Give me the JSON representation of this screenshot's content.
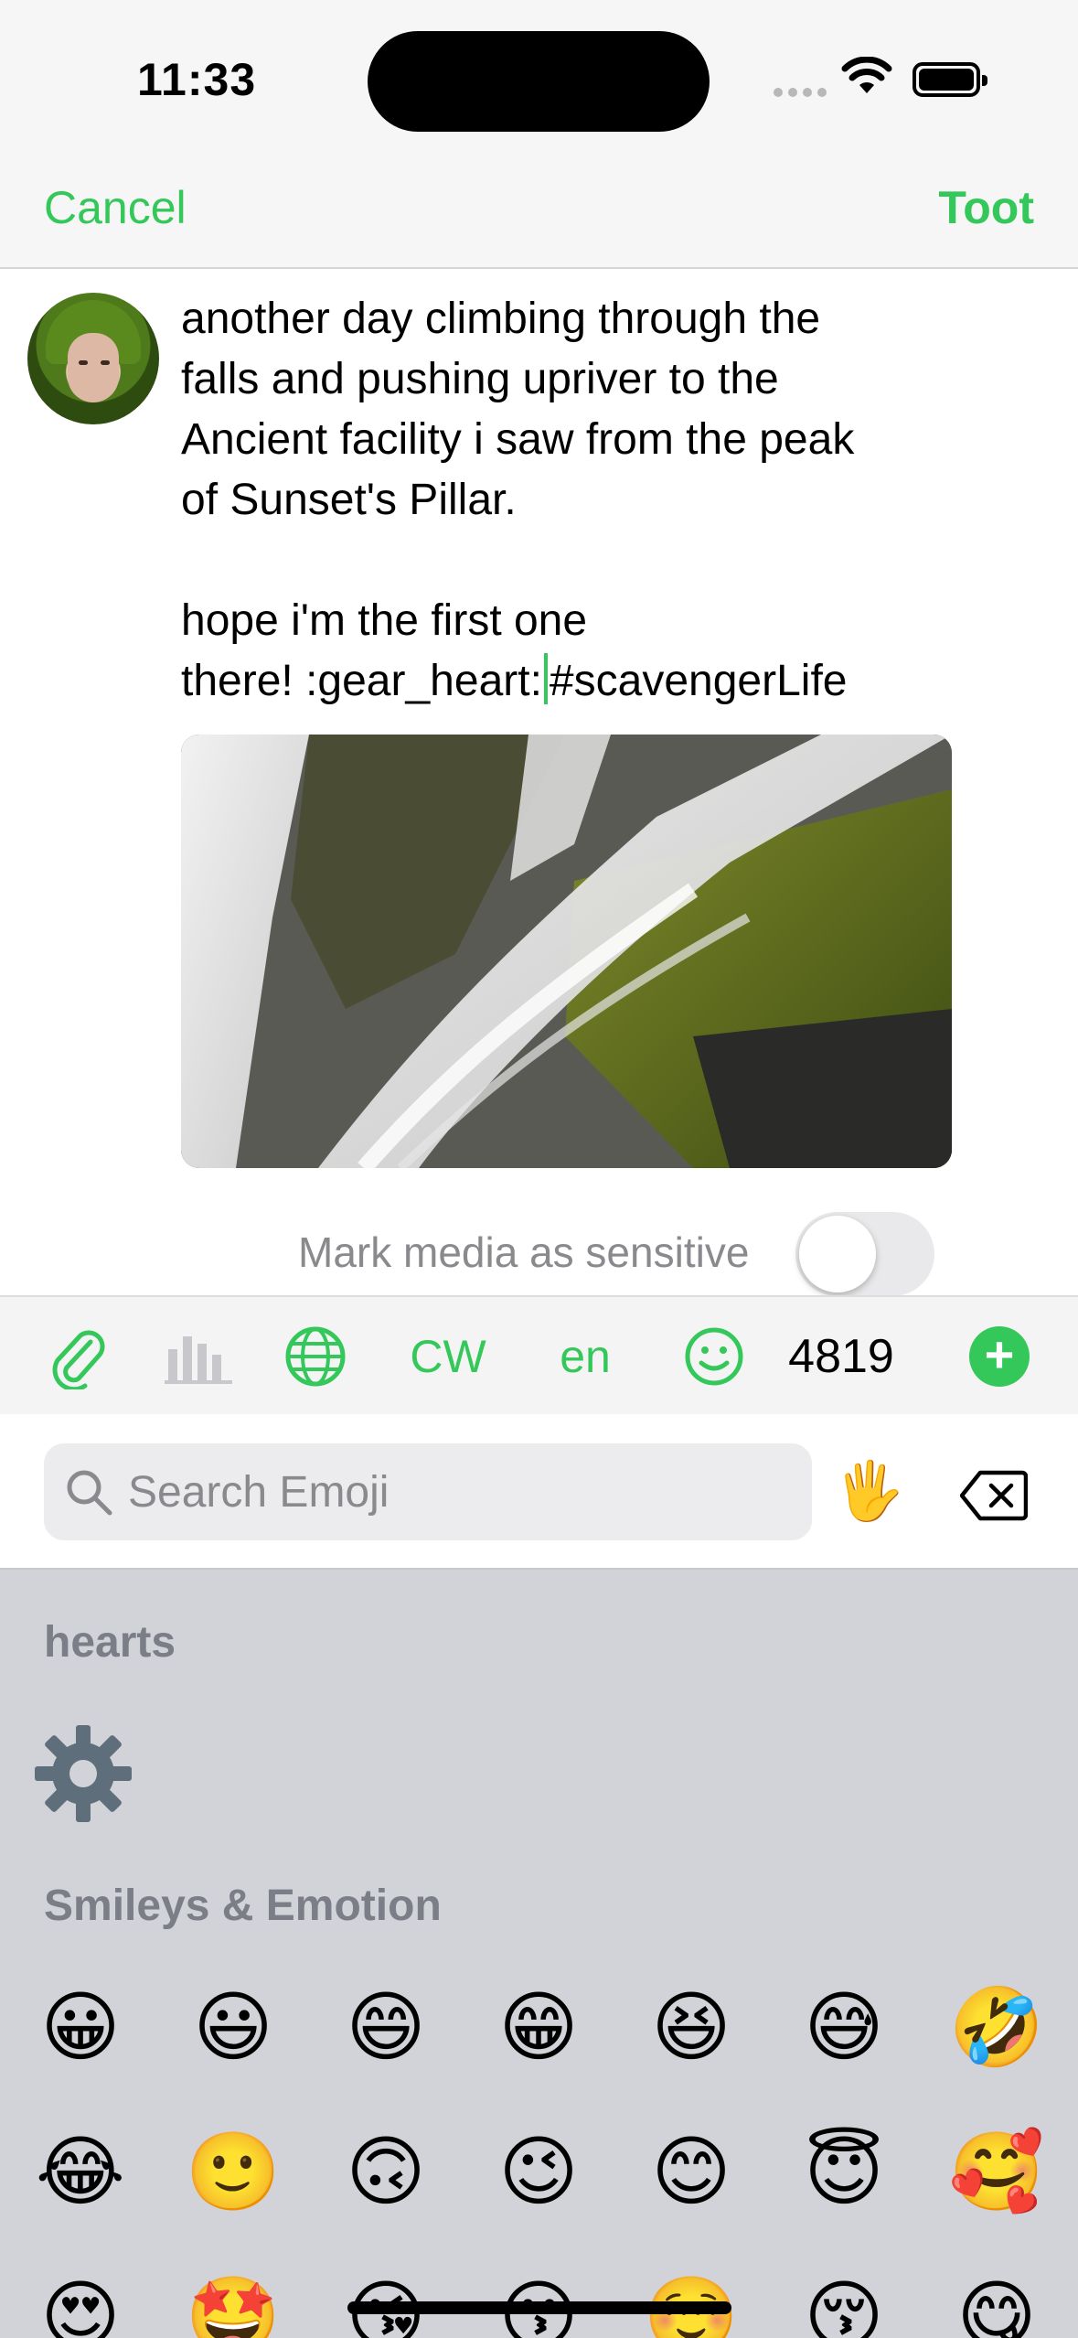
{
  "status_bar": {
    "time": "11:33"
  },
  "nav": {
    "cancel_label": "Cancel",
    "toot_label": "Toot"
  },
  "compose": {
    "text_before_cursor": "another day climbing through the\nfalls and pushing upriver to the\nAncient facility i saw from the peak\nof Sunset's Pillar.\n\nhope i'm the first one\nthere! :gear_heart:",
    "text_after_cursor": "#scavengerLife",
    "sensitive_label": "Mark media as sensitive",
    "sensitive_on": false
  },
  "toolbar": {
    "cw_label": "CW",
    "language_label": "en",
    "char_count": "4819"
  },
  "emoji_picker": {
    "search_placeholder": "Search Emoji",
    "skin_tone_emoji": "🖐",
    "sections": [
      {
        "title": "hearts"
      },
      {
        "title": "Smileys & Emotion"
      }
    ],
    "smileys_row1": [
      "😀",
      "😃",
      "😄",
      "😁",
      "😆",
      "😅",
      "🤣"
    ],
    "smileys_row2": [
      "😂",
      "🙂",
      "🙃",
      "😉",
      "😊",
      "😇",
      "🥰"
    ],
    "smileys_row3": [
      "😍",
      "🤩",
      "😘",
      "😗",
      "☺️",
      "😚",
      "😋"
    ]
  },
  "colors": {
    "accent": "#34c759",
    "panel_bg": "#d1d3d9",
    "bar_bg": "#f6f6f6"
  },
  "icons": [
    "paperclip-icon",
    "poll-icon",
    "globe-icon",
    "smiley-icon",
    "plus-icon",
    "search-icon",
    "backspace-icon",
    "gear-icon",
    "wifi-icon",
    "battery-icon"
  ]
}
